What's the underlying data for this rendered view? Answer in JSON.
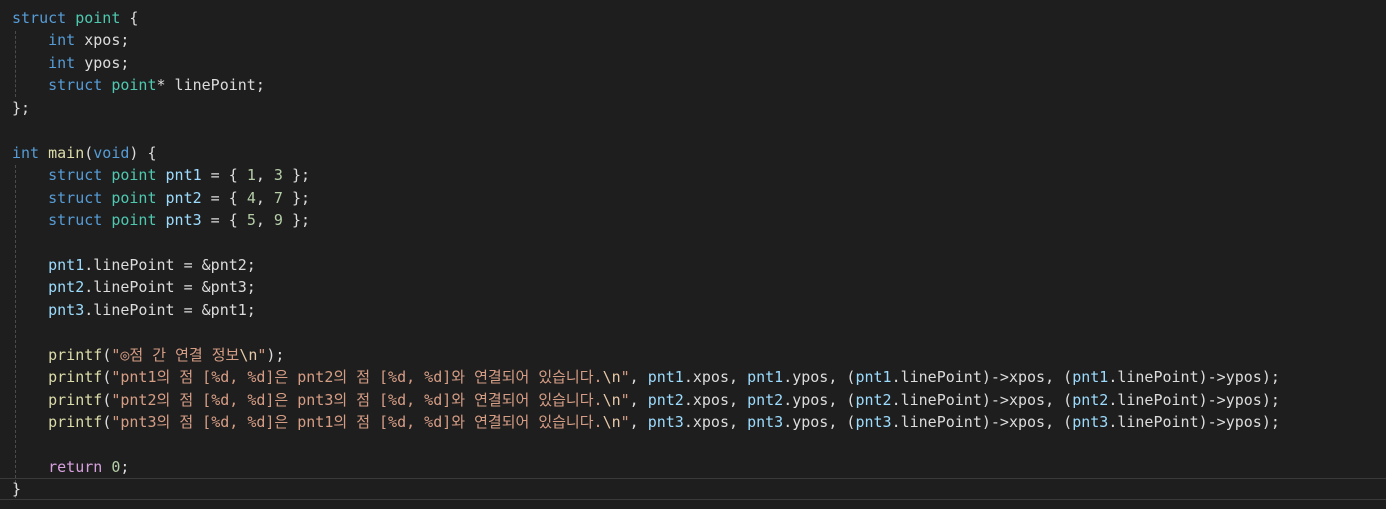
{
  "editor": {
    "theme_colors": {
      "background": "#1e1e1e",
      "keyword": "#569cd6",
      "type": "#4ec9b0",
      "text": "#dcdcdc",
      "variable": "#9cdcfe",
      "function": "#dcdcaa",
      "string": "#d69d85",
      "escape": "#e8c9a9",
      "number": "#b5cea8",
      "control": "#d8a0df"
    },
    "lines": [
      [
        [
          "struct",
          "keyword"
        ],
        [
          " ",
          "text"
        ],
        [
          "point",
          "type"
        ],
        [
          " {",
          "text"
        ]
      ],
      [
        [
          "    ",
          "text"
        ],
        [
          "int",
          "keyword"
        ],
        [
          " xpos;",
          "text"
        ]
      ],
      [
        [
          "    ",
          "text"
        ],
        [
          "int",
          "keyword"
        ],
        [
          " ypos;",
          "text"
        ]
      ],
      [
        [
          "    ",
          "text"
        ],
        [
          "struct",
          "keyword"
        ],
        [
          " ",
          "text"
        ],
        [
          "point",
          "type"
        ],
        [
          "* linePoint;",
          "text"
        ]
      ],
      [
        [
          "};",
          "text"
        ]
      ],
      [],
      [
        [
          "int",
          "keyword"
        ],
        [
          " ",
          "text"
        ],
        [
          "main",
          "function"
        ],
        [
          "(",
          "text"
        ],
        [
          "void",
          "keyword"
        ],
        [
          ") {",
          "text"
        ]
      ],
      [
        [
          "    ",
          "text"
        ],
        [
          "struct",
          "keyword"
        ],
        [
          " ",
          "text"
        ],
        [
          "point",
          "type"
        ],
        [
          " ",
          "text"
        ],
        [
          "pnt1",
          "variable"
        ],
        [
          " = { ",
          "text"
        ],
        [
          "1",
          "number"
        ],
        [
          ", ",
          "text"
        ],
        [
          "3",
          "number"
        ],
        [
          " };",
          "text"
        ]
      ],
      [
        [
          "    ",
          "text"
        ],
        [
          "struct",
          "keyword"
        ],
        [
          " ",
          "text"
        ],
        [
          "point",
          "type"
        ],
        [
          " ",
          "text"
        ],
        [
          "pnt2",
          "variable"
        ],
        [
          " = { ",
          "text"
        ],
        [
          "4",
          "number"
        ],
        [
          ", ",
          "text"
        ],
        [
          "7",
          "number"
        ],
        [
          " };",
          "text"
        ]
      ],
      [
        [
          "    ",
          "text"
        ],
        [
          "struct",
          "keyword"
        ],
        [
          " ",
          "text"
        ],
        [
          "point",
          "type"
        ],
        [
          " ",
          "text"
        ],
        [
          "pnt3",
          "variable"
        ],
        [
          " = { ",
          "text"
        ],
        [
          "5",
          "number"
        ],
        [
          ", ",
          "text"
        ],
        [
          "9",
          "number"
        ],
        [
          " };",
          "text"
        ]
      ],
      [],
      [
        [
          "    ",
          "text"
        ],
        [
          "pnt1",
          "variable"
        ],
        [
          ".linePoint = &pnt2;",
          "text"
        ]
      ],
      [
        [
          "    ",
          "text"
        ],
        [
          "pnt2",
          "variable"
        ],
        [
          ".linePoint = &pnt3;",
          "text"
        ]
      ],
      [
        [
          "    ",
          "text"
        ],
        [
          "pnt3",
          "variable"
        ],
        [
          ".linePoint = &pnt1;",
          "text"
        ]
      ],
      [],
      [
        [
          "    ",
          "text"
        ],
        [
          "printf",
          "function"
        ],
        [
          "(",
          "text"
        ],
        [
          "\"◎점 간 연결 정보",
          "string"
        ],
        [
          "\\n",
          "escape"
        ],
        [
          "\"",
          "string"
        ],
        [
          ");",
          "text"
        ]
      ],
      [
        [
          "    ",
          "text"
        ],
        [
          "printf",
          "function"
        ],
        [
          "(",
          "text"
        ],
        [
          "\"pnt1의 점 [%d, %d]은 pnt2의 점 [%d, %d]와 연결되어 있습니다.",
          "string"
        ],
        [
          "\\n",
          "escape"
        ],
        [
          "\"",
          "string"
        ],
        [
          ", ",
          "text"
        ],
        [
          "pnt1",
          "variable"
        ],
        [
          ".xpos, ",
          "text"
        ],
        [
          "pnt1",
          "variable"
        ],
        [
          ".ypos, (",
          "text"
        ],
        [
          "pnt1",
          "variable"
        ],
        [
          ".linePoint)->xpos, (",
          "text"
        ],
        [
          "pnt1",
          "variable"
        ],
        [
          ".linePoint)->ypos);",
          "text"
        ]
      ],
      [
        [
          "    ",
          "text"
        ],
        [
          "printf",
          "function"
        ],
        [
          "(",
          "text"
        ],
        [
          "\"pnt2의 점 [%d, %d]은 pnt3의 점 [%d, %d]와 연결되어 있습니다.",
          "string"
        ],
        [
          "\\n",
          "escape"
        ],
        [
          "\"",
          "string"
        ],
        [
          ", ",
          "text"
        ],
        [
          "pnt2",
          "variable"
        ],
        [
          ".xpos, ",
          "text"
        ],
        [
          "pnt2",
          "variable"
        ],
        [
          ".ypos, (",
          "text"
        ],
        [
          "pnt2",
          "variable"
        ],
        [
          ".linePoint)->xpos, (",
          "text"
        ],
        [
          "pnt2",
          "variable"
        ],
        [
          ".linePoint)->ypos);",
          "text"
        ]
      ],
      [
        [
          "    ",
          "text"
        ],
        [
          "printf",
          "function"
        ],
        [
          "(",
          "text"
        ],
        [
          "\"pnt3의 점 [%d, %d]은 pnt1의 점 [%d, %d]와 연결되어 있습니다.",
          "string"
        ],
        [
          "\\n",
          "escape"
        ],
        [
          "\"",
          "string"
        ],
        [
          ", ",
          "text"
        ],
        [
          "pnt3",
          "variable"
        ],
        [
          ".xpos, ",
          "text"
        ],
        [
          "pnt3",
          "variable"
        ],
        [
          ".ypos, (",
          "text"
        ],
        [
          "pnt3",
          "variable"
        ],
        [
          ".linePoint)->xpos, (",
          "text"
        ],
        [
          "pnt3",
          "variable"
        ],
        [
          ".linePoint)->ypos);",
          "text"
        ]
      ],
      [],
      [
        [
          "    ",
          "text"
        ],
        [
          "return",
          "control"
        ],
        [
          " ",
          "text"
        ],
        [
          "0",
          "number"
        ],
        [
          ";",
          "text"
        ]
      ],
      [
        [
          "}",
          "text"
        ]
      ]
    ]
  }
}
